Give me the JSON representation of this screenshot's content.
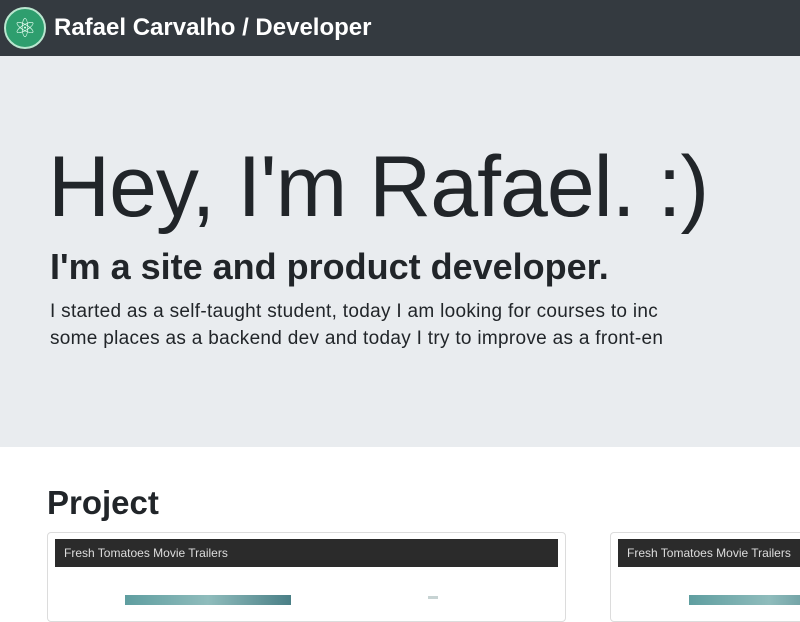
{
  "navbar": {
    "brand": "Rafael Carvalho / Developer",
    "logo_icon": "atom-icon"
  },
  "hero": {
    "title": "Hey, I'm Rafael. :)",
    "subtitle": "I'm a site and product developer.",
    "bio_line1": "I started as a self-taught student, today I am looking for courses to inc",
    "bio_line2": "some places as a backend dev and today I try to improve as a front-en"
  },
  "projects": {
    "title": "Project",
    "cards": [
      {
        "header": "Fresh Tomatoes Movie Trailers"
      },
      {
        "header": "Fresh Tomatoes Movie Trailers"
      }
    ]
  },
  "colors": {
    "navbar": "#343a40",
    "jumbotron": "#e9ecef",
    "logo": "#2e9e6e"
  }
}
